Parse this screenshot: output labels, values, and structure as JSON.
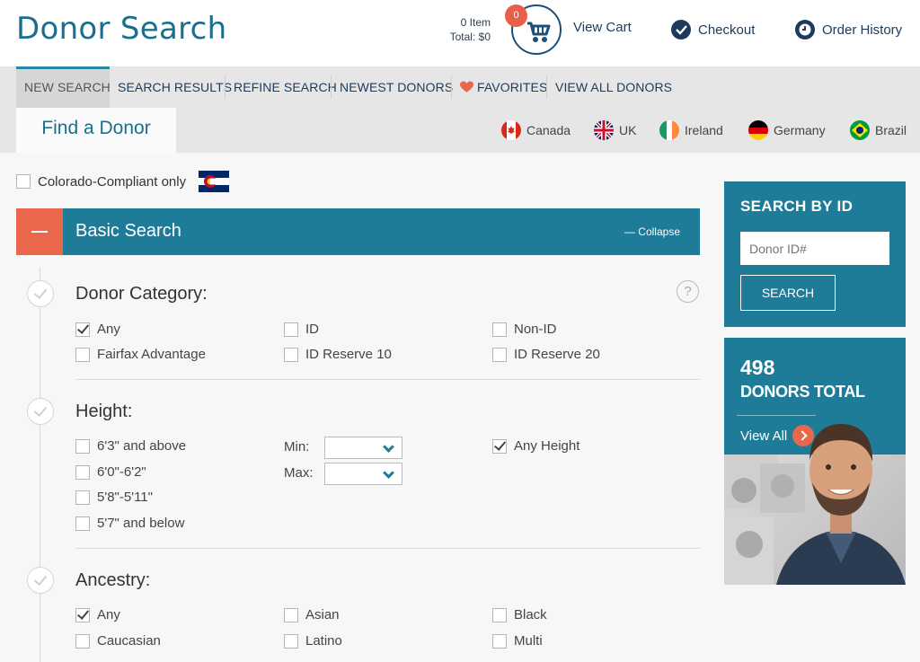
{
  "header": {
    "brand": "Donor Search",
    "cart_count": "0",
    "cart_items": "0 Item",
    "cart_total": "Total: $0",
    "view_cart": "View Cart",
    "checkout": "Checkout",
    "order_history": "Order History"
  },
  "nav": {
    "items": [
      {
        "label": "NEW SEARCH"
      },
      {
        "label": "SEARCH RESULTS"
      },
      {
        "label": "REFINE SEARCH"
      },
      {
        "label": "NEWEST DONORS"
      },
      {
        "label": "FAVORITES"
      },
      {
        "label": "VIEW ALL DONORS"
      }
    ]
  },
  "country_bar": {
    "tab": "Find a Donor",
    "countries": [
      {
        "label": "Canada"
      },
      {
        "label": "UK"
      },
      {
        "label": "Ireland"
      },
      {
        "label": "Germany"
      },
      {
        "label": "Brazil"
      }
    ]
  },
  "filters": {
    "colorado_label": "Colorado-Compliant only",
    "basic_title": "Basic Search",
    "collapse": "— Collapse",
    "help": "?",
    "donor_category": {
      "title": "Donor Category:",
      "options": [
        {
          "label": "Any",
          "checked": true
        },
        {
          "label": "ID",
          "checked": false
        },
        {
          "label": "Non-ID",
          "checked": false
        },
        {
          "label": "Fairfax Advantage",
          "checked": false
        },
        {
          "label": "ID Reserve 10",
          "checked": false
        },
        {
          "label": "ID Reserve 20",
          "checked": false
        }
      ]
    },
    "height": {
      "title": "Height:",
      "options": [
        {
          "label": "6'3\" and above",
          "checked": false
        },
        {
          "label": "6'0\"-6'2\"",
          "checked": false
        },
        {
          "label": "5'8\"-5'11\"",
          "checked": false
        },
        {
          "label": "5'7\" and below",
          "checked": false
        }
      ],
      "min_label": "Min:",
      "max_label": "Max:",
      "any_height": "Any Height",
      "any_checked": true
    },
    "ancestry": {
      "title": "Ancestry:",
      "options": [
        {
          "label": "Any",
          "checked": true
        },
        {
          "label": "Asian",
          "checked": false
        },
        {
          "label": "Black",
          "checked": false
        },
        {
          "label": "Caucasian",
          "checked": false
        },
        {
          "label": "Latino",
          "checked": false
        },
        {
          "label": "Multi",
          "checked": false
        }
      ]
    }
  },
  "sidebar": {
    "search_by_id_title": "SEARCH BY ID",
    "donor_id_placeholder": "Donor ID#",
    "search_button": "SEARCH",
    "donors_count": "498",
    "donors_label": "DONORS TOTAL",
    "view_all": "View All"
  },
  "colors": {
    "brand": "#1b6f8c",
    "accent": "#e9684c",
    "panel": "#1f7c98"
  }
}
